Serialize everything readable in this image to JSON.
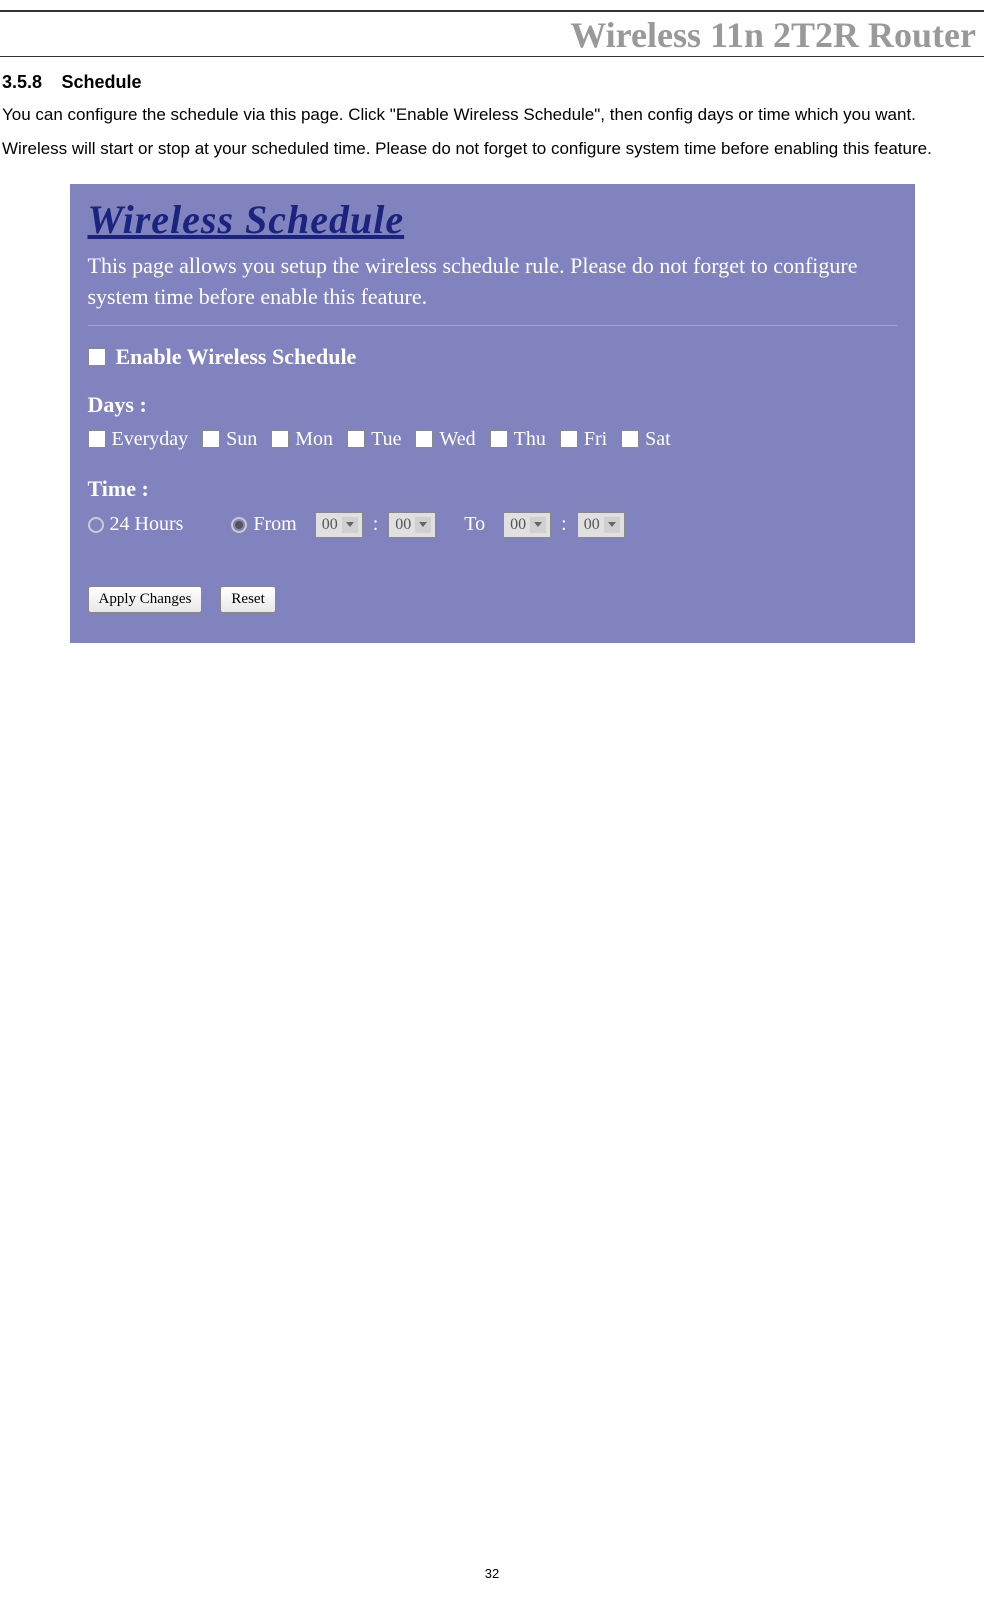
{
  "header": {
    "title": "Wireless 11n 2T2R Router"
  },
  "section": {
    "number": "3.5.8",
    "title": "Schedule",
    "body": "You can configure the schedule via this page. Click \"Enable Wireless Schedule\", then config days or time which you want. Wireless will start or stop at your scheduled time. Please do not forget to configure system time before enabling this feature."
  },
  "panel": {
    "title": "Wireless Schedule",
    "description": "This page allows you setup the wireless schedule rule. Please do not forget to configure system time before enable this feature.",
    "enable_label": "Enable Wireless Schedule",
    "days_label": "Days :",
    "days": [
      "Everyday",
      "Sun",
      "Mon",
      "Tue",
      "Wed",
      "Thu",
      "Fri",
      "Sat"
    ],
    "time_label": "Time :",
    "time_24h": "24 Hours",
    "time_from": "From",
    "time_to": "To",
    "select_val": "00",
    "apply_btn": "Apply Changes",
    "reset_btn": "Reset"
  },
  "page_number": "32"
}
